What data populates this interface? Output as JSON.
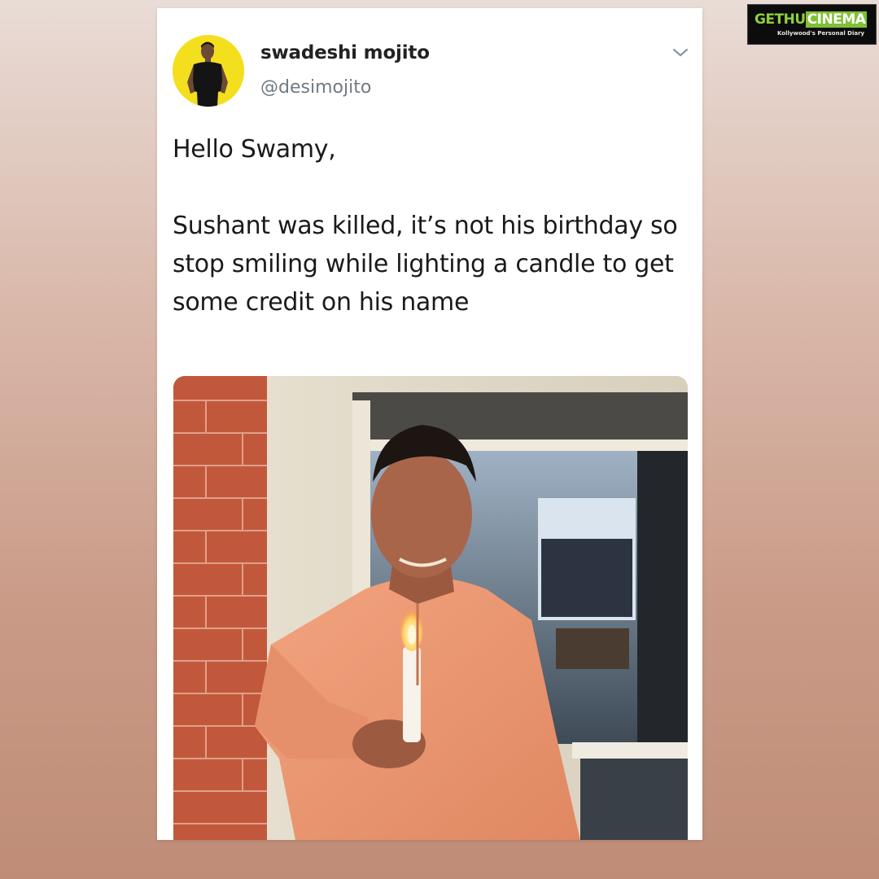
{
  "tweet": {
    "display_name": "swadeshi mojito",
    "handle": "@desimojito",
    "text_paragraphs": [
      "Hello Swamy,",
      "Sushant was killed, it’s not his birthday so stop smiling while lighting a candle to get some credit on his name"
    ],
    "menu_icon": "chevron-down-icon",
    "avatar_color": "#f4df1f"
  },
  "watermark": {
    "logo_part_1": "GETHU",
    "logo_part_2": "CINEMA",
    "tagline": "Kollywood's Personal Diary"
  },
  "colors": {
    "card_background": "#ffffff",
    "page_gradient_top": "#e9dcd6",
    "page_gradient_bottom": "#bf8d77",
    "handle_text": "#6f7a84"
  }
}
